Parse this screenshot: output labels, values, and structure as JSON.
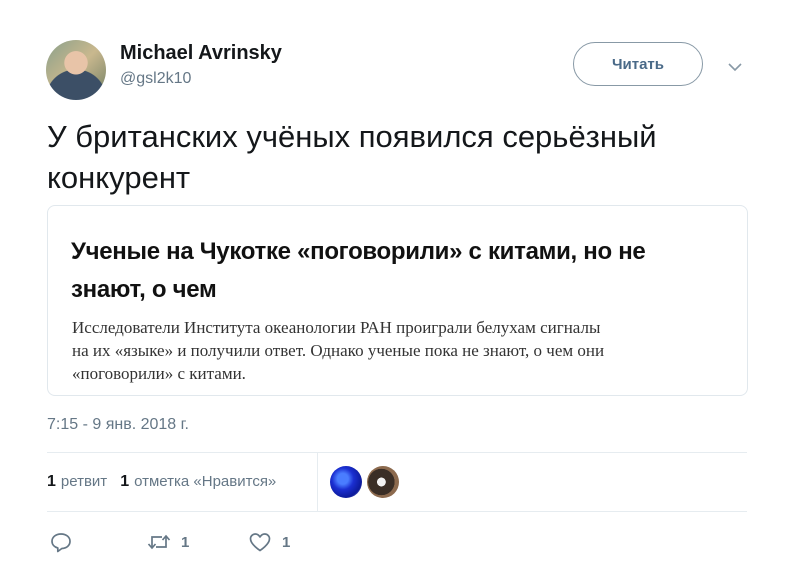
{
  "author": {
    "name": "Michael Avrinsky",
    "handle": "@gsl2k10",
    "follow_label": "Читать"
  },
  "tweet": {
    "text_line1": "У британских учёных появился серьёзный",
    "text_line2": "конкурент"
  },
  "card": {
    "title_line1": "Ученые на Чукотке «поговорили» с китами, но не",
    "title_line2": "знают, о чем",
    "desc_line1": "Исследователи Института океанологии РАН проиграли белухам сигналы",
    "desc_line2": "на их «языке» и получили ответ. Однако ученые пока не знают, о чем они",
    "desc_line3": "«поговорили» с китами."
  },
  "timestamp": "7:15 - 9 янв. 2018 г.",
  "stats": {
    "retweets_count": "1",
    "retweets_label": "ретвит",
    "likes_count": "1",
    "likes_label": "отметка «Нравится»"
  },
  "actions": {
    "retweet_count": "1",
    "like_count": "1"
  },
  "icons": {
    "reply": "reply-icon",
    "retweet": "retweet-icon",
    "like": "heart-icon",
    "caret": "chevron-down-icon"
  },
  "colors": {
    "text": "#14171a",
    "secondary": "#657786",
    "border": "#e1e8ed"
  }
}
